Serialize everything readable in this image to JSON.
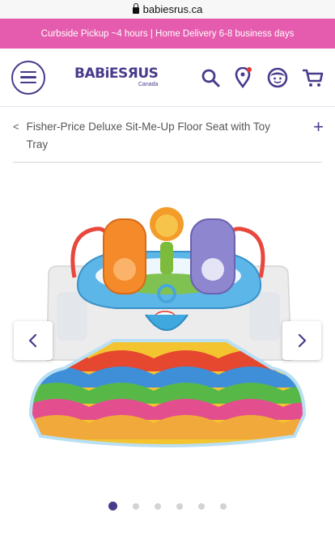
{
  "browser": {
    "url": "babiesrus.ca",
    "lock_icon": "lock-icon"
  },
  "promo": {
    "text": "Curbside Pickup ~4 hours | Home Delivery 6-8 business days",
    "color": "#e55cae"
  },
  "header": {
    "logo": {
      "main": "BABiESЯUS",
      "sub": "Canada"
    },
    "icons": [
      "menu-icon",
      "search-icon",
      "location-pin-icon",
      "account-face-icon",
      "cart-icon"
    ],
    "brand_color": "#4a3a8c"
  },
  "breadcrumb": {
    "back": "<",
    "title": "Fisher-Price Deluxe Sit-Me-Up Floor Seat with Toy Tray",
    "expand": "+"
  },
  "gallery": {
    "image_subject": "Floor seat with toy tray",
    "prev_icon": "chevron-left-icon",
    "next_icon": "chevron-right-icon",
    "total_images": 6,
    "active_index": 0
  }
}
